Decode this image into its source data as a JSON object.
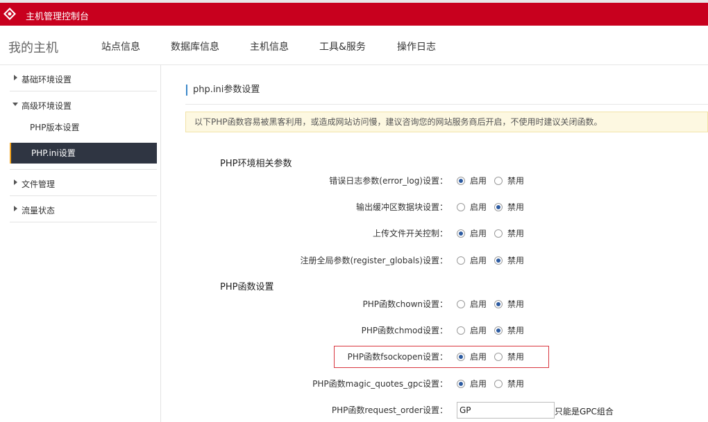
{
  "app": {
    "title": "主机管理控制台"
  },
  "nav": {
    "home": "我的主机",
    "items": [
      "站点信息",
      "数据库信息",
      "主机信息",
      "工具&服务",
      "操作日志"
    ]
  },
  "sidebar": {
    "groups": [
      {
        "label": "基础环境设置",
        "expanded": false
      },
      {
        "label": "高级环境设置",
        "expanded": true,
        "children": [
          "PHP版本设置",
          "PHP.ini设置"
        ]
      },
      {
        "label": "文件管理",
        "expanded": false
      },
      {
        "label": "流量状态",
        "expanded": false
      }
    ],
    "active": "PHP.ini设置"
  },
  "main": {
    "section_title": "php.ini参数设置",
    "notice": "以下PHP函数容易被黑客利用，或造成网站访问慢，建议咨询您的网站服务商后开启，不使用时建议关闭函数。",
    "enable_label": "启用",
    "disable_label": "禁用",
    "group1_title": "PHP环境相关参数",
    "group2_title": "PHP函数设置",
    "rows": [
      {
        "label": "错误日志参数(error_log)设置：",
        "value": "启用"
      },
      {
        "label": "输出缓冲区数据块设置：",
        "value": "禁用"
      },
      {
        "label": "上传文件开关控制：",
        "value": "启用"
      },
      {
        "label": "注册全局参数(register_globals)设置：",
        "value": "禁用"
      },
      {
        "label": "PHP函数chown设置：",
        "value": "禁用"
      },
      {
        "label": "PHP函数chmod设置：",
        "value": "禁用"
      },
      {
        "label": "PHP函数fsockopen设置：",
        "value": "启用"
      },
      {
        "label": "PHP函数magic_quotes_gpc设置：",
        "value": "启用"
      }
    ],
    "request_order": {
      "label": "PHP函数request_order设置：",
      "value": "GP",
      "hint": "只能是GPC组合"
    }
  },
  "colors": {
    "brand_red": "#c8001e",
    "sidebar_active": "#2f3542",
    "accent_blue": "#3a87c9",
    "highlight_border": "#d9363e"
  }
}
